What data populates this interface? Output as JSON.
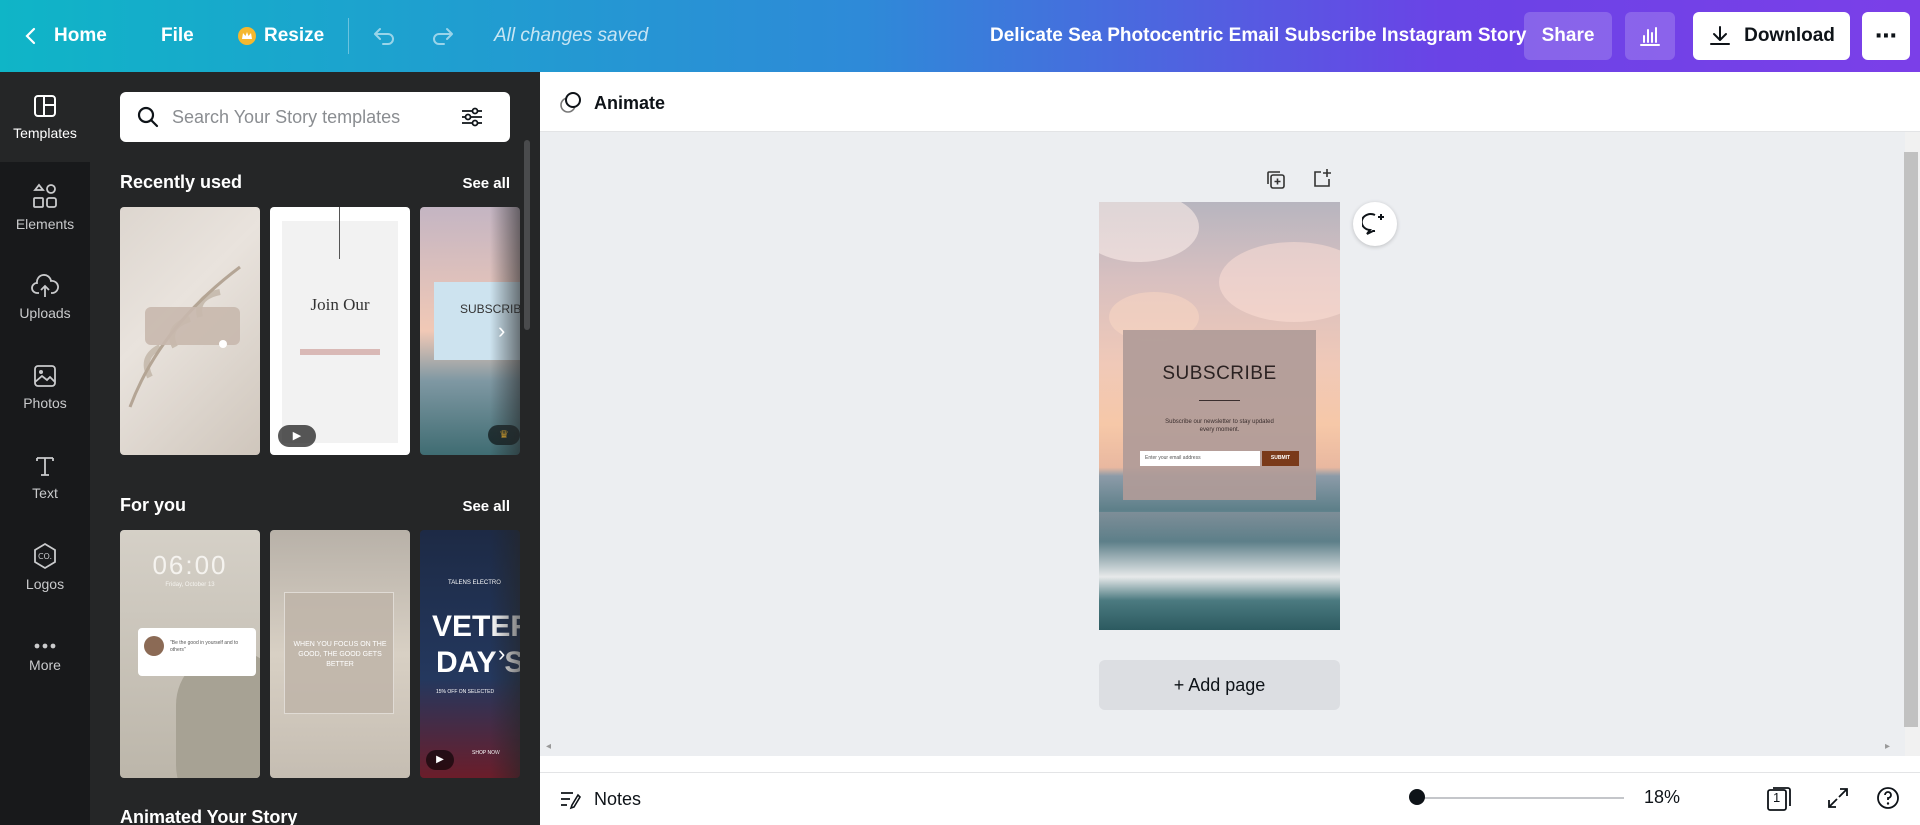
{
  "topbar": {
    "home_label": "Home",
    "file_label": "File",
    "resize_label": "Resize",
    "saved_status": "All changes saved",
    "doc_title": "Delicate Sea Photocentric Email Subscribe Instagram Story",
    "share_label": "Share",
    "download_label": "Download",
    "more_icon": "⋯"
  },
  "rail": {
    "items": [
      {
        "label": "Templates",
        "icon": "templates-icon"
      },
      {
        "label": "Elements",
        "icon": "elements-icon"
      },
      {
        "label": "Uploads",
        "icon": "uploads-icon"
      },
      {
        "label": "Photos",
        "icon": "photos-icon"
      },
      {
        "label": "Text",
        "icon": "text-icon"
      },
      {
        "label": "Logos",
        "icon": "logos-icon"
      },
      {
        "label": "More",
        "icon": "more-icon"
      }
    ]
  },
  "panel": {
    "search_placeholder": "Search Your Story templates",
    "recently_used": "Recently used",
    "for_you": "For you",
    "see_all": "See all",
    "next_section": "Animated Your Story"
  },
  "thumbs": {
    "t2_title": "Join Our",
    "t3_title": "SUBSCRIB",
    "t4_time": "06:00",
    "t4_date": "Friday, October 13",
    "t4_quote": "\"Be the good in yourself and to others\"",
    "t5_quote": "WHEN YOU FOCUS ON THE GOOD, THE GOOD GETS BETTER",
    "t6_brand": "TALENS ELECTRO",
    "t6_title1": "VETERA",
    "t6_title2": "DAY SA",
    "t6_sub": "15% OFF ON SELECTED",
    "t6_cta": "SHOP NOW"
  },
  "editor": {
    "animate_label": "Animate",
    "card_title": "SUBSCRIBE",
    "card_body": "Subscribe our newsletter to stay updated every moment.",
    "card_input_placeholder": "Enter your email address",
    "card_submit": "SUBMIT",
    "add_page_label": "+ Add page"
  },
  "bottombar": {
    "notes_label": "Notes",
    "zoom_level": "18%",
    "page_count": "1",
    "zoom_fraction": 0.18
  },
  "colors": {
    "topbar_start": "#0fb5c7",
    "topbar_end": "#7b3fe8",
    "crown": "#f5b82e",
    "submit_bg": "#7a3a1a"
  }
}
